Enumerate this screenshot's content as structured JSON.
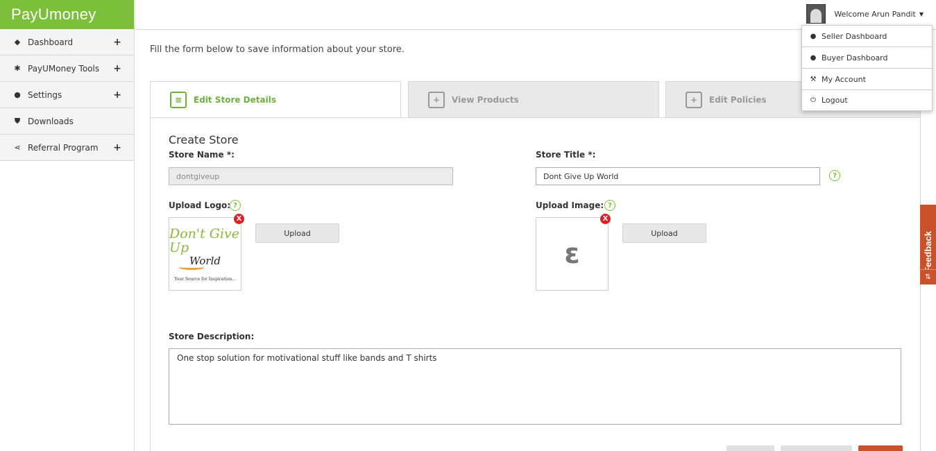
{
  "brand": {
    "logo_text_a": "PayU",
    "logo_text_b": "money",
    "color": "#7cbf3a"
  },
  "sidebar": {
    "items": [
      {
        "label": "Dashboard",
        "icon": "tag-icon",
        "expandable": true
      },
      {
        "label": "PayUMoney Tools",
        "icon": "tools-icon",
        "expandable": true
      },
      {
        "label": "Settings",
        "icon": "user-icon",
        "expandable": true
      },
      {
        "label": "Downloads",
        "icon": "shield-icon",
        "expandable": false
      },
      {
        "label": "Referral Program",
        "icon": "share-icon",
        "expandable": true
      }
    ],
    "plus": "+"
  },
  "header": {
    "welcome": "Welcome Arun Pandit",
    "caret": "▼"
  },
  "user_menu": {
    "items": [
      {
        "label": "Seller Dashboard",
        "icon": "seller-icon"
      },
      {
        "label": "Buyer Dashboard",
        "icon": "buyer-icon"
      },
      {
        "label": "My Account",
        "icon": "wrench-icon"
      },
      {
        "label": "Logout",
        "icon": "power-icon"
      }
    ]
  },
  "main": {
    "intro": "Fill the form below to save information about your store.",
    "tabs": [
      {
        "label": "Edit Store Details",
        "active": true
      },
      {
        "label": "View Products",
        "active": false
      },
      {
        "label": "Edit Policies",
        "active": false
      }
    ],
    "form": {
      "title": "Create Store",
      "store_name_label": "Store Name *:",
      "store_name_value": "dontgiveup",
      "store_title_label": "Store Title *:",
      "store_title_value": "Dont Give Up World",
      "upload_logo_label": "Upload Logo:",
      "upload_image_label": "Upload Image:",
      "upload_button": "Upload",
      "remove_mark": "X",
      "help_mark": "?",
      "logo_line1": "Don't Give Up",
      "logo_line2": "World",
      "logo_line3": "Your Source for Inspiration...",
      "image_glyph": "ε",
      "description_label": "Store Description:",
      "description_value": "One stop solution for motivational  stuff like bands and T shirts"
    }
  },
  "feedback": {
    "label": "Feedback",
    "color": "#c9512b"
  }
}
